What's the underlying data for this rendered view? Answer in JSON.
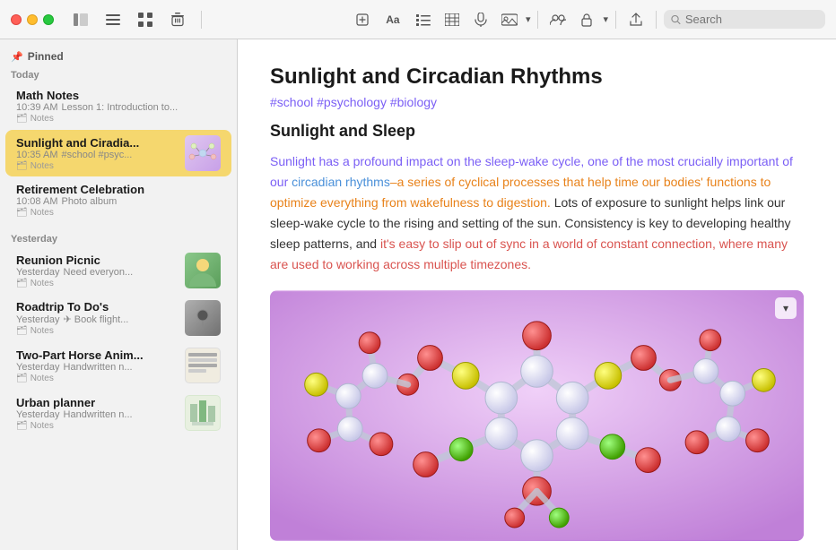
{
  "window": {
    "title": "Notes"
  },
  "titlebar": {
    "traffic": [
      "red",
      "yellow",
      "green"
    ],
    "buttons": [
      {
        "name": "sidebar-toggle",
        "icon": "⊞",
        "label": "Toggle Sidebar"
      },
      {
        "name": "list-view",
        "icon": "≡",
        "label": "List View"
      },
      {
        "name": "grid-view",
        "icon": "⊞",
        "label": "Grid View"
      },
      {
        "name": "delete",
        "icon": "🗑",
        "label": "Delete"
      }
    ],
    "right_buttons": [
      {
        "name": "new-note",
        "icon": "✏️"
      },
      {
        "name": "format-text",
        "icon": "Aa"
      },
      {
        "name": "checklist",
        "icon": "☰"
      },
      {
        "name": "table",
        "icon": "⊞"
      },
      {
        "name": "audio",
        "icon": "♪"
      },
      {
        "name": "attachment",
        "icon": "🖼"
      },
      {
        "name": "collaborate",
        "icon": "⊕"
      },
      {
        "name": "lock",
        "icon": "🔒"
      },
      {
        "name": "share",
        "icon": "↑"
      }
    ],
    "search": {
      "placeholder": "Search",
      "value": ""
    }
  },
  "sidebar": {
    "pinned_label": "Pinned",
    "sections": [
      {
        "label": "Today",
        "notes": [
          {
            "title": "Math Notes",
            "time": "10:39 AM",
            "preview": "Lesson 1: Introduction to...",
            "folder": "Notes",
            "has_thumb": false,
            "active": false
          },
          {
            "title": "Sunlight and Ciradia...",
            "time": "10:35 AM",
            "preview": "#school #psyc...",
            "folder": "Notes",
            "has_thumb": true,
            "thumb_type": "molecule",
            "active": true
          },
          {
            "title": "Retirement Celebration",
            "time": "10:08 AM",
            "preview": "Photo album",
            "folder": "Notes",
            "has_thumb": false,
            "active": false
          }
        ]
      },
      {
        "label": "Yesterday",
        "notes": [
          {
            "title": "Reunion Picnic",
            "time": "Yesterday",
            "preview": "Need everyon...",
            "folder": "Notes",
            "has_thumb": true,
            "thumb_type": "reunion",
            "active": false
          },
          {
            "title": "Roadtrip To Do's",
            "time": "Yesterday",
            "preview": "✈ Book flight...",
            "folder": "Notes",
            "has_thumb": true,
            "thumb_type": "road",
            "active": false
          },
          {
            "title": "Two-Part Horse Anim...",
            "time": "Yesterday",
            "preview": "Handwritten n...",
            "folder": "Notes",
            "has_thumb": true,
            "thumb_type": "horse",
            "active": false
          },
          {
            "title": "Urban planner",
            "time": "Yesterday",
            "preview": "Handwritten n...",
            "folder": "Notes",
            "has_thumb": true,
            "thumb_type": "urban",
            "active": false
          }
        ]
      }
    ]
  },
  "content": {
    "title": "Sunlight and Circadian Rhythms",
    "tags": "#school #psychology #biology",
    "subtitle": "Sunlight and Sleep",
    "paragraphs": [
      {
        "segments": [
          {
            "text": "Sunlight has a profound impact on the sleep-wake cycle, one of the most crucially important of our ",
            "style": "purple"
          },
          {
            "text": "circadian rhythms",
            "style": "blue"
          },
          {
            "text": "–a series of cyclical processes that help time our bodies' functions to optimize everything from wakefulness to digestion.",
            "style": "orange"
          },
          {
            "text": " Lots of exposure to sunlight helps link our sleep-wake cycle to the rising and setting of the sun. ",
            "style": "normal"
          },
          {
            "text": "Consistency is key to developing healthy sleep patterns,",
            "style": "normal"
          },
          {
            "text": " and ",
            "style": "normal"
          },
          {
            "text": "it's easy to slip out of sync in a world of constant connection, where many are used to working across multiple timezones.",
            "style": "red"
          }
        ]
      }
    ]
  }
}
